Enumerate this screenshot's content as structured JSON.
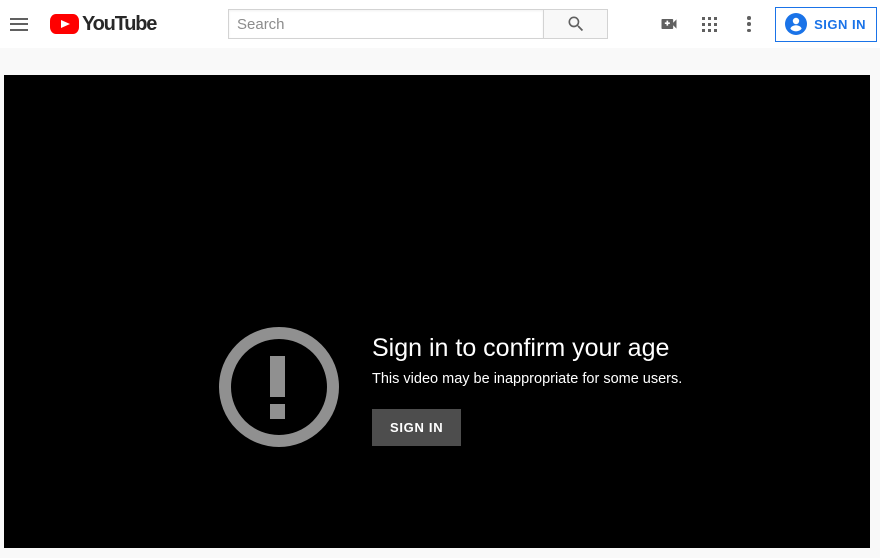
{
  "header": {
    "menu_label": "Guide",
    "logo_text": "YouTube",
    "search": {
      "placeholder": "Search",
      "value": "",
      "button_label": "Search"
    },
    "icons": {
      "create": "video-camera-plus-icon",
      "apps": "apps-grid-icon",
      "more": "more-vertical-icon",
      "account": "account-circle-icon"
    },
    "signin_label": "SIGN IN"
  },
  "player": {
    "icon": "alert-circle-icon",
    "title": "Sign in to confirm your age",
    "subtitle": "This video may be inappropriate for some users.",
    "signin_label": "SIGN IN"
  },
  "colors": {
    "brand_red": "#ff0000",
    "link_blue": "#1a73e8",
    "page_bg": "#f9f9f9",
    "player_bg": "#000000",
    "icon_gray": "#909090",
    "button_gray": "#4d4d4d"
  }
}
